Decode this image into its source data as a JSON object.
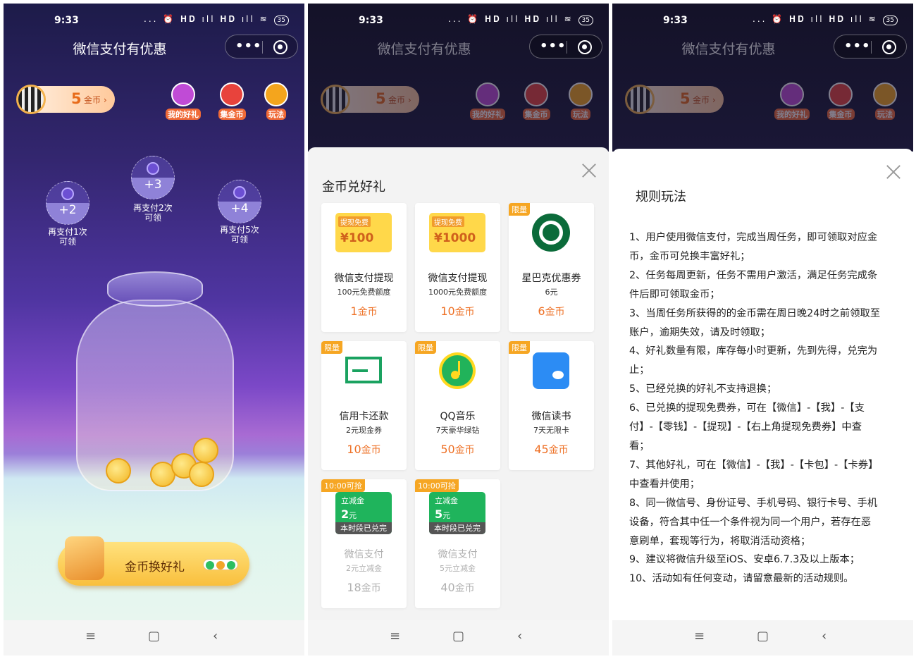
{
  "status": {
    "time": "9:33",
    "icons": "... ⏰ 𝐇𝐃 ıll 𝐇𝐃 ıll ≋",
    "battery": "35"
  },
  "header": {
    "title": "微信支付有优惠",
    "more": "•••"
  },
  "coins": {
    "count": "5",
    "unit": "金币",
    "arrow": "›"
  },
  "shortcuts": [
    {
      "label": "我的好礼",
      "color": "#c04bd6"
    },
    {
      "label": "集金币",
      "color": "#e8433c"
    },
    {
      "label": "玩法",
      "color": "#f4a51d"
    }
  ],
  "bubbles": [
    {
      "plus": "+2",
      "caption": [
        "再支付1次",
        "可领"
      ]
    },
    {
      "plus": "+3",
      "caption": [
        "再支付2次",
        "可领"
      ]
    },
    {
      "plus": "+4",
      "caption": [
        "再支付5次",
        "可领"
      ]
    }
  ],
  "cta": {
    "label": "金币换好礼"
  },
  "navbar": {
    "menu": "≡",
    "home": "▢",
    "back": "‹"
  },
  "exchange": {
    "title": "金币兑好礼",
    "items": [
      {
        "tag": "",
        "name": "微信支付提现",
        "sub": "100元免费额度",
        "price": "1",
        "unit": "金币",
        "voucher_tag": "提现免费",
        "voucher_amount": "¥100"
      },
      {
        "tag": "",
        "name": "微信支付提现",
        "sub": "1000元免费额度",
        "price": "10",
        "unit": "金币",
        "voucher_tag": "提现免费",
        "voucher_amount": "¥1000"
      },
      {
        "tag": "限量",
        "name": "星巴克优惠券",
        "sub": "6元",
        "price": "6",
        "unit": "金币"
      },
      {
        "tag": "限量",
        "name": "信用卡还款",
        "sub": "2元现金券",
        "price": "10",
        "unit": "金币"
      },
      {
        "tag": "限量",
        "name": "QQ音乐",
        "sub": "7天豪华绿钻",
        "price": "50",
        "unit": "金币"
      },
      {
        "tag": "限量",
        "name": "微信读书",
        "sub": "7天无限卡",
        "price": "45",
        "unit": "金币"
      },
      {
        "tag": "10:00可抢",
        "name": "微信支付",
        "sub": "2元立减金",
        "price": "18",
        "unit": "金币",
        "voucher_tag": "立减金",
        "voucher_amount": "2",
        "voucher_unit": "元",
        "soldout": "本时段已兑完"
      },
      {
        "tag": "10:00可抢",
        "name": "微信支付",
        "sub": "5元立减金",
        "price": "40",
        "unit": "金币",
        "voucher_tag": "立减金",
        "voucher_amount": "5",
        "voucher_unit": "元",
        "soldout": "本时段已兑完"
      }
    ]
  },
  "rules": {
    "title": "规则玩法",
    "lines": [
      "1、用户使用微信支付，完成当周任务，即可领取对应金",
      "币，金币可兑换丰富好礼；",
      "2、任务每周更新，任务不需用户激活，满足任务完成条",
      "件后即可领取金币；",
      "3、当周任务所获得的的金币需在周日晚24时之前领取至",
      "账户，逾期失效，请及时领取；",
      "4、好礼数量有限，库存每小时更新，先到先得，兑完为",
      "止；",
      "5、已经兑换的好礼不支持退换；",
      "6、已兑换的提现免费券，可在【微信】-【我】-【支",
      "付】-【零钱】-【提现】-【右上角提现免费券】中查",
      "看；",
      "7、其他好礼，可在【微信】-【我】-【卡包】-【卡券】",
      "中查看并使用；",
      "8、同一微信号、身份证号、手机号码、银行卡号、手机",
      "设备，符合其中任一个条件视为同一个用户，若存在恶",
      "意刷单，套现等行为，将取消活动资格；",
      "9、建议将微信升级至iOS、安卓6.7.3及以上版本；",
      "10、活动如有任何变动，请留意最新的活动规则。"
    ]
  }
}
